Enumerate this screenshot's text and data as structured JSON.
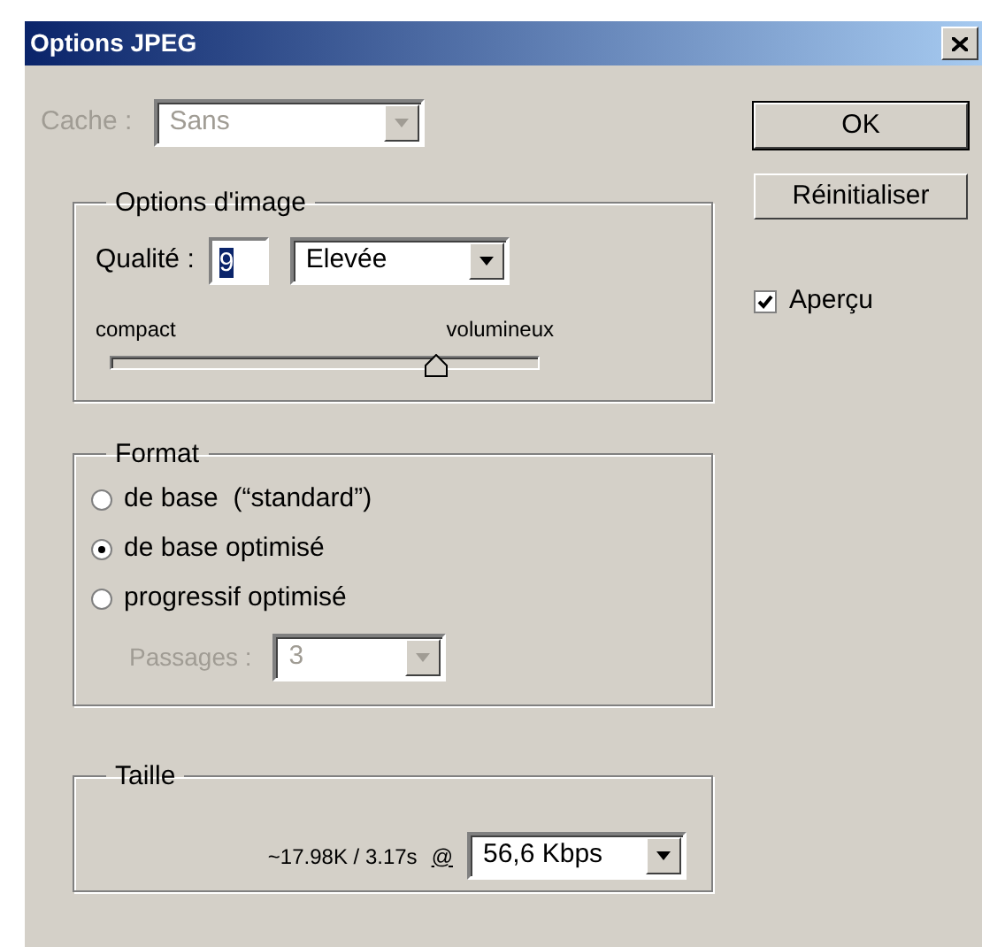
{
  "window": {
    "title": "Options JPEG"
  },
  "cache": {
    "label": "Cache :",
    "value": "Sans",
    "disabled": true
  },
  "image_options": {
    "title": "Options d'image",
    "quality_label": "Qualité :",
    "quality_value": "9",
    "quality_value_selected": true,
    "quality_preset": "Elevée",
    "slider": {
      "min_label": "compact",
      "max_label": "volumineux",
      "level": 0.76
    }
  },
  "format": {
    "title": "Format",
    "options": [
      {
        "label": "de base  (“standard”)",
        "selected": false
      },
      {
        "label": "de base optimisé",
        "selected": true
      },
      {
        "label": "progressif optimisé",
        "selected": false
      }
    ],
    "passes": {
      "label": "Passages :",
      "value": "3",
      "disabled": true
    }
  },
  "size": {
    "title": "Taille",
    "estimate": "~17.98K / 3.17s",
    "at": "@",
    "speed": "56,6 Kbps"
  },
  "buttons": [
    {
      "label": "OK",
      "default": true
    },
    {
      "label": "Réinitialiser",
      "default": false
    }
  ],
  "preview": {
    "label": "Aperçu",
    "checked": true
  }
}
